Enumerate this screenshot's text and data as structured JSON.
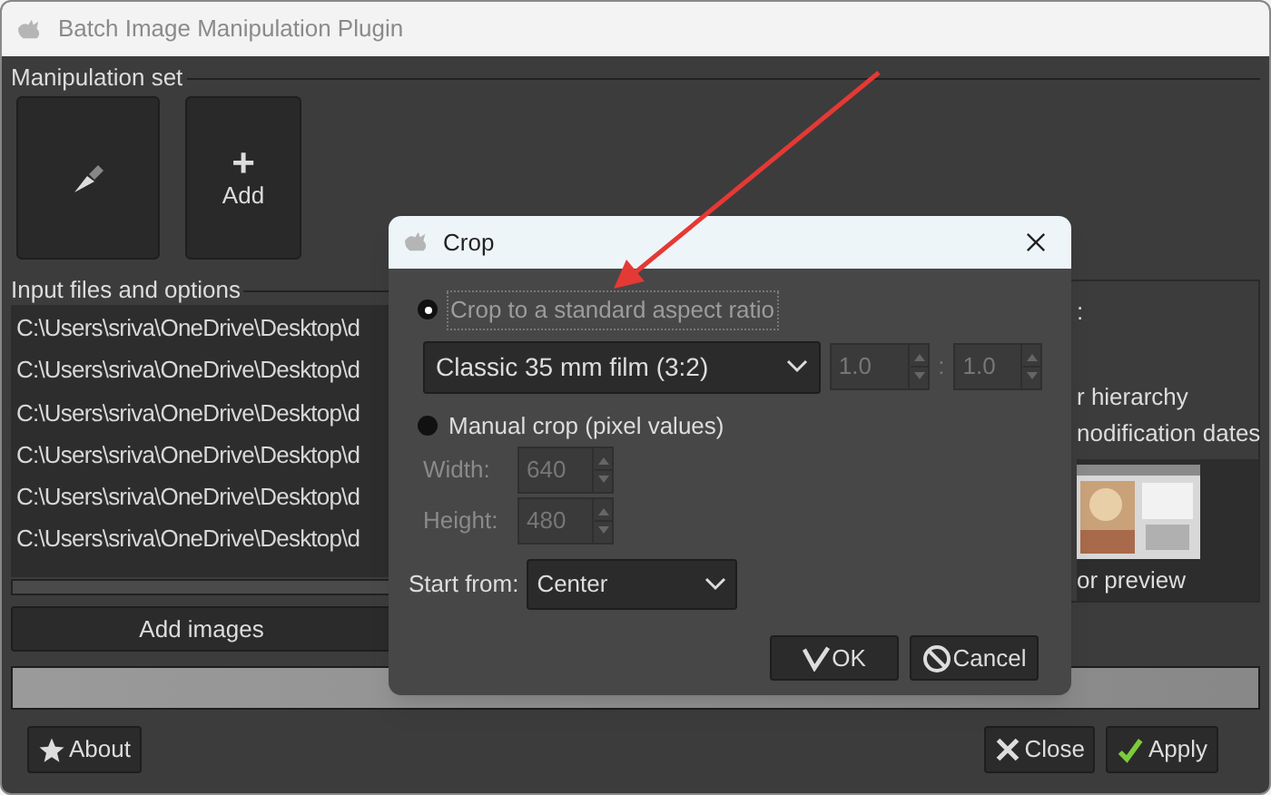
{
  "window": {
    "title": "Batch Image Manipulation Plugin"
  },
  "manipulation_set": {
    "label": "Manipulation set",
    "items": [
      {
        "kind": "tool"
      },
      {
        "kind": "add",
        "symbol": "+",
        "label": "Add"
      }
    ]
  },
  "input_files": {
    "label": "Input files and options",
    "files": [
      "C:\\Users\\sriva\\OneDrive\\Desktop\\d",
      "C:\\Users\\sriva\\OneDrive\\Desktop\\d",
      "C:\\Users\\sriva\\OneDrive\\Desktop\\d",
      "C:\\Users\\sriva\\OneDrive\\Desktop\\d",
      "C:\\Users\\sriva\\OneDrive\\Desktop\\d",
      "C:\\Users\\sriva\\OneDrive\\Desktop\\d"
    ],
    "add_button": "Add images"
  },
  "output_options": {
    "items": [
      ":",
      "r hierarchy",
      "nodification dates"
    ],
    "preview_label": "or preview"
  },
  "progress": {
    "level": 1
  },
  "buttons": [
    {
      "kind": "about",
      "label": "About"
    },
    {
      "kind": "close",
      "label": "Close"
    },
    {
      "kind": "apply",
      "label": "Apply"
    }
  ],
  "dialog": {
    "title": "Crop",
    "options": [
      {
        "label": "Crop to a standard aspect ratio",
        "selected": true
      },
      {
        "label": "Manual crop (pixel values)",
        "selected": false
      }
    ],
    "ratio": {
      "value": "Classic 35 mm film (3:2)",
      "a": "1.0",
      "separator": ":",
      "b": "1.0",
      "disabled": true
    },
    "size_fields": [
      {
        "label": "Width:",
        "value": "640",
        "disabled": true
      },
      {
        "label": "Height:",
        "value": "480",
        "disabled": true
      }
    ],
    "start_from": {
      "label": "Start from:",
      "value": "Center"
    },
    "buttons": [
      {
        "kind": "ok",
        "label": "OK"
      },
      {
        "kind": "cancel",
        "label": "Cancel"
      }
    ]
  }
}
